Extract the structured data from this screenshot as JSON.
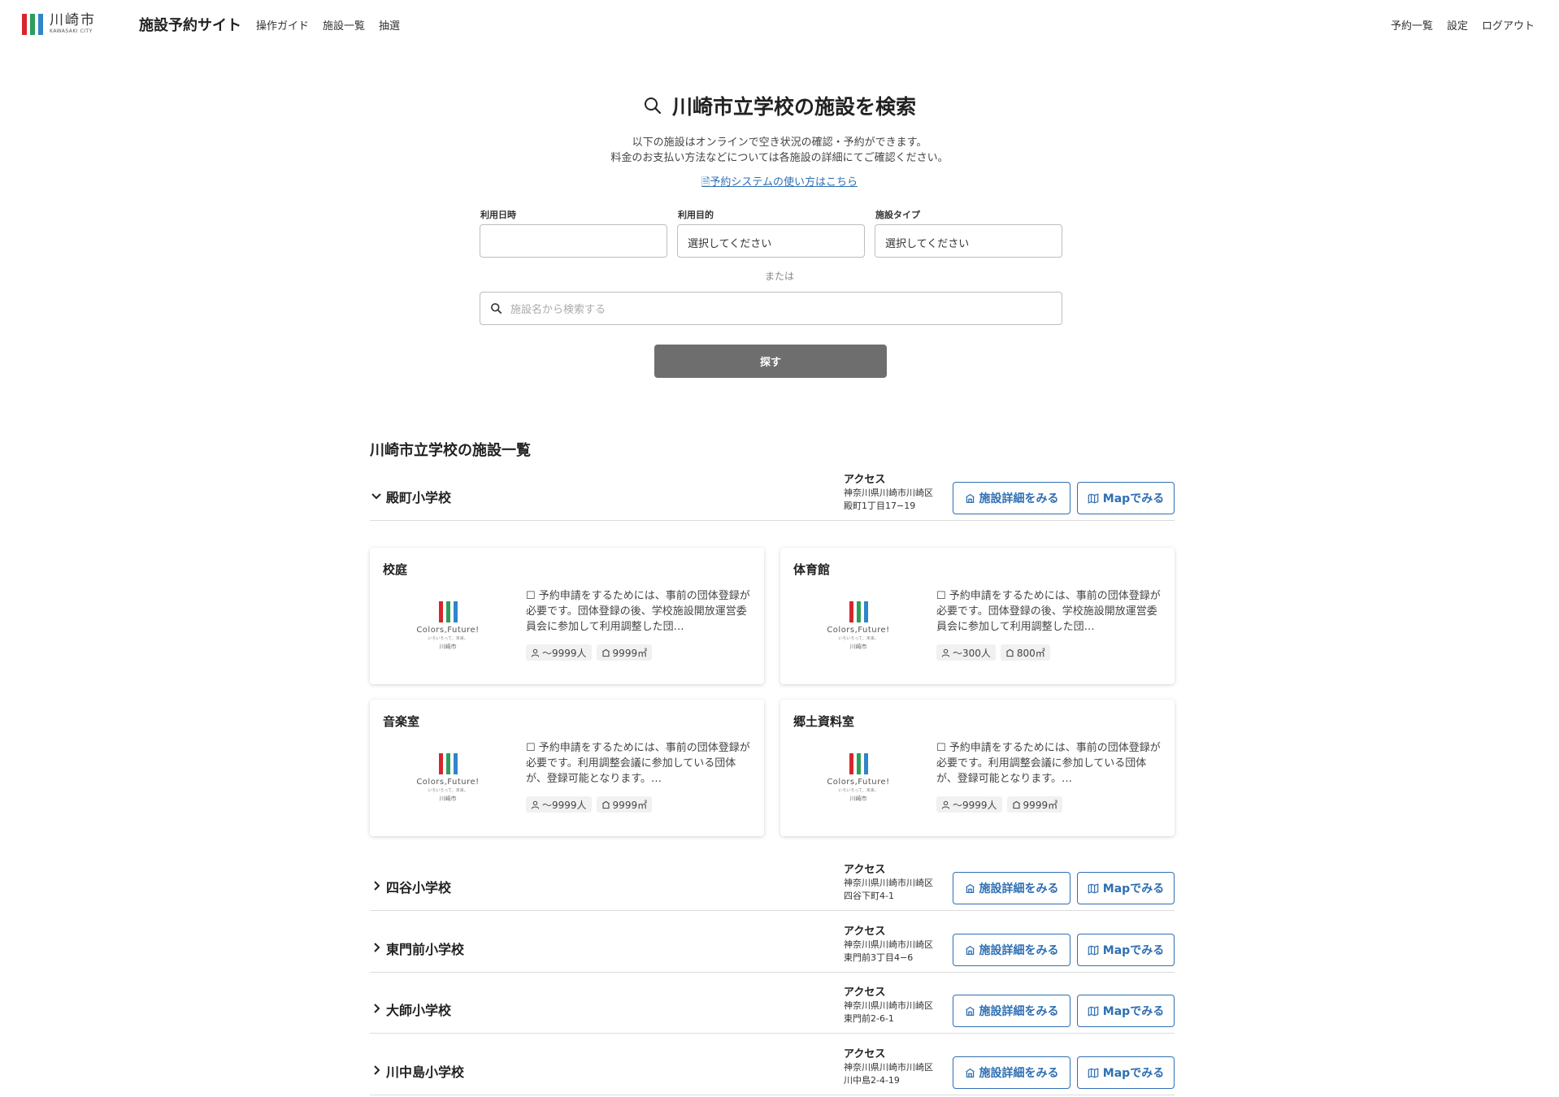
{
  "header": {
    "logo_kanji": "川崎市",
    "logo_en": "KAWASAKI CITY",
    "site_title": "施設予約サイト",
    "nav_left": [
      "操作ガイド",
      "施設一覧",
      "抽選"
    ],
    "nav_right": [
      "予約一覧",
      "設定",
      "ログアウト"
    ]
  },
  "search": {
    "title": "川崎市立学校の施設を検索",
    "intro_line1": "以下の施設はオンラインで空き状況の確認・予約ができます。",
    "intro_line2": "料金のお支払い方法などについては各施設の詳細にてご確認ください。",
    "guide_link": "予約システムの使い方はこちら",
    "date_label": "利用日時",
    "date_value": "",
    "purpose_label": "利用目的",
    "purpose_value": "選択してください",
    "type_label": "施設タイプ",
    "type_value": "選択してください",
    "or_text": "または",
    "name_placeholder": "施設名から検索する",
    "search_button": "探す"
  },
  "list": {
    "title": "川崎市立学校の施設一覧",
    "access_label": "アクセス",
    "detail_button": "施設詳細をみる",
    "map_button": "Mapでみる",
    "logo_text": "Colors,Future!",
    "logo_sub": "いろいろって、未来。",
    "logo_city": "川崎市",
    "schools": [
      {
        "name": "殿町小学校",
        "expanded": true,
        "addr1": "神奈川県川崎市川崎区",
        "addr2": "殿町1丁目17−19"
      },
      {
        "name": "四谷小学校",
        "expanded": false,
        "addr1": "神奈川県川崎市川崎区",
        "addr2": "四谷下町4-1"
      },
      {
        "name": "東門前小学校",
        "expanded": false,
        "addr1": "神奈川県川崎市川崎区",
        "addr2": "東門前3丁目4−6"
      },
      {
        "name": "大師小学校",
        "expanded": false,
        "addr1": "神奈川県川崎市川崎区",
        "addr2": "東門前2-6-1"
      },
      {
        "name": "川中島小学校",
        "expanded": false,
        "addr1": "神奈川県川崎市川崎区",
        "addr2": "川中島2-4-19"
      }
    ],
    "facilities": [
      {
        "name": "校庭",
        "desc": "予約申請をするためには、事前の団体登録が必要です。団体登録の後、学校施設開放運営委員会に参加して利用調整した団…",
        "capacity": "〜9999人",
        "area": "9999㎡"
      },
      {
        "name": "体育館",
        "desc": "予約申請をするためには、事前の団体登録が必要です。団体登録の後、学校施設開放運営委員会に参加して利用調整した団…",
        "capacity": "〜300人",
        "area": "800㎡"
      },
      {
        "name": "音楽室",
        "desc": "予約申請をするためには、事前の団体登録が必要です。利用調整会議に参加している団体が、登録可能となります。…",
        "capacity": "〜9999人",
        "area": "9999㎡"
      },
      {
        "name": "郷土資料室",
        "desc": "予約申請をするためには、事前の団体登録が必要です。利用調整会議に参加している団体が、登録可能となります。…",
        "capacity": "〜9999人",
        "area": "9999㎡"
      }
    ]
  },
  "colors": {
    "accent": "#2f6fb3",
    "logo_red": "#d7262b",
    "logo_green": "#2e9e5b",
    "logo_blue": "#2f86c9",
    "button_gray": "#6e6e6e"
  }
}
